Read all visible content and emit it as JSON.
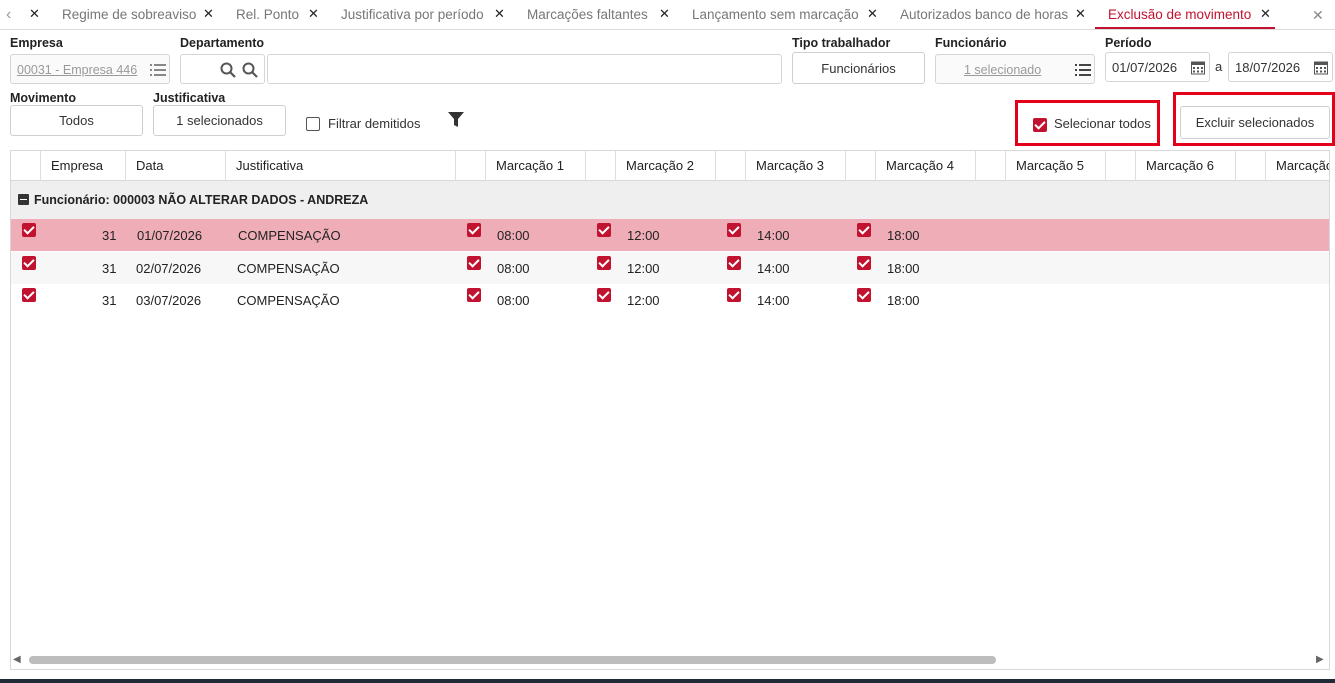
{
  "tabs": [
    {
      "label": "Regime de sobreaviso",
      "active": false
    },
    {
      "label": "Rel. Ponto",
      "active": false
    },
    {
      "label": "Justificativa por período",
      "active": false
    },
    {
      "label": "Marcações faltantes",
      "active": false
    },
    {
      "label": "Lançamento sem marcação",
      "active": false
    },
    {
      "label": "Autorizados banco de horas",
      "active": false
    },
    {
      "label": "Exclusão de movimento",
      "active": true
    }
  ],
  "filters": {
    "empresa_label": "Empresa",
    "empresa_value": "00031 - Empresa 446",
    "departamento_label": "Departamento",
    "tipo_trabalhador_label": "Tipo trabalhador",
    "tipo_trabalhador_value": "Funcionários",
    "funcionario_label": "Funcionário",
    "funcionario_value": "1 selecionado",
    "periodo_label": "Período",
    "periodo_inicio": "01/07/2026",
    "periodo_sep": "a",
    "periodo_fim": "18/07/2026",
    "movimento_label": "Movimento",
    "movimento_value": "Todos",
    "justificativa_label": "Justificativa",
    "justificativa_value": "1 selecionados",
    "filtrar_demitidos_label": "Filtrar demitidos",
    "selecionar_todos_label": "Selecionar todos",
    "excluir_label": "Excluir selecionados"
  },
  "grid": {
    "columns": [
      "Empresa",
      "Data",
      "Justificativa",
      "Marcação 1",
      "Marcação 2",
      "Marcação 3",
      "Marcação 4",
      "Marcação 5",
      "Marcação 6",
      "Marcação"
    ],
    "group_label": "Funcionário: 000003 NÃO ALTERAR DADOS - ANDREZA",
    "rows": [
      {
        "empresa": "31",
        "data": "01/07/2026",
        "justificativa": "COMPENSAÇÃO",
        "m1": "08:00",
        "m2": "12:00",
        "m3": "14:00",
        "m4": "18:00"
      },
      {
        "empresa": "31",
        "data": "02/07/2026",
        "justificativa": "COMPENSAÇÃO",
        "m1": "08:00",
        "m2": "12:00",
        "m3": "14:00",
        "m4": "18:00"
      },
      {
        "empresa": "31",
        "data": "03/07/2026",
        "justificativa": "COMPENSAÇÃO",
        "m1": "08:00",
        "m2": "12:00",
        "m3": "14:00",
        "m4": "18:00"
      }
    ]
  },
  "colors": {
    "accent": "#c1122f",
    "selected_row": "#efaeb7",
    "highlight_box": "#e3001b"
  }
}
